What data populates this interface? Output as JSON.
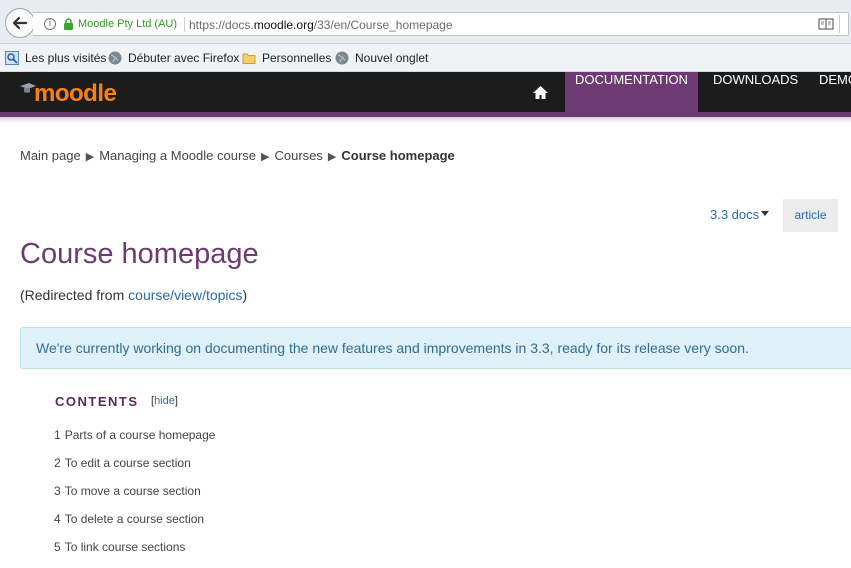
{
  "browser": {
    "site_identity": "Moodle Pty Ltd (AU)",
    "url_prefix": "https://docs.",
    "url_host": "moodle.org",
    "url_path": "/33/en/Course_homepage",
    "bookmarks": [
      {
        "label": "Les plus visités",
        "icon": "most-visited-icon"
      },
      {
        "label": "Débuter avec Firefox",
        "icon": "globe-icon"
      },
      {
        "label": "Personnelles",
        "icon": "folder-icon"
      },
      {
        "label": "Nouvel onglet",
        "icon": "globe-icon"
      }
    ]
  },
  "header": {
    "logo_text": "moodle",
    "nav": {
      "documentation": "DOCUMENTATION",
      "downloads": "DOWNLOADS",
      "demo": "DEMO"
    },
    "accent_color": "#6d3a73",
    "logo_color": "#f98012"
  },
  "breadcrumb": {
    "items": [
      "Main page",
      "Managing a Moodle course",
      "Courses"
    ],
    "separator": "▶",
    "current": "Course homepage"
  },
  "controls": {
    "docs_version": "3.3 docs",
    "article_tab": "article"
  },
  "page": {
    "title": "Course homepage",
    "redirect_prefix": "(Redirected from ",
    "redirect_link": "course/view/topics",
    "redirect_suffix": ")"
  },
  "notice": {
    "text": "We're currently working on documenting the new features and improvements in 3.3, ready for its release very soon."
  },
  "toc": {
    "title": "CONTENTS",
    "hide_open": "[",
    "hide_label": "hide",
    "hide_close": "]",
    "items": [
      {
        "num": "1",
        "label": "Parts of a course homepage"
      },
      {
        "num": "2",
        "label": "To edit a course section"
      },
      {
        "num": "3",
        "label": "To move a course section"
      },
      {
        "num": "4",
        "label": "To delete a course section"
      },
      {
        "num": "5",
        "label": "To link course sections"
      }
    ]
  }
}
